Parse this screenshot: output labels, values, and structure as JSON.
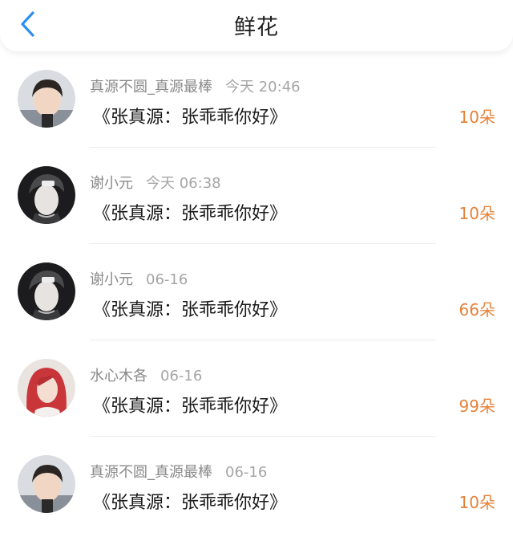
{
  "header": {
    "title": "鲜花",
    "back_icon": "chevron-left-icon",
    "accent_color": "#2d8ff0"
  },
  "records": [
    {
      "user": "真源不圆_真源最棒",
      "time": "今天 20:46",
      "gift": "《张真源：张乖乖你好》",
      "count": "10朵",
      "avatar": "boy-portrait"
    },
    {
      "user": "谢小元",
      "time": "今天 06:38",
      "gift": "《张真源：张乖乖你好》",
      "count": "10朵",
      "avatar": "dark-cap-portrait"
    },
    {
      "user": "谢小元",
      "time": "06-16",
      "gift": "《张真源：张乖乖你好》",
      "count": "66朵",
      "avatar": "dark-cap-portrait"
    },
    {
      "user": "水心木各",
      "time": "06-16",
      "gift": "《张真源：张乖乖你好》",
      "count": "99朵",
      "avatar": "red-hair-portrait"
    },
    {
      "user": "真源不圆_真源最棒",
      "time": "06-16",
      "gift": "《张真源：张乖乖你好》",
      "count": "10朵",
      "avatar": "boy-portrait"
    }
  ],
  "colors": {
    "count": "#e5823a",
    "meta": "#8a8a8a",
    "text": "#1a1a1a"
  }
}
